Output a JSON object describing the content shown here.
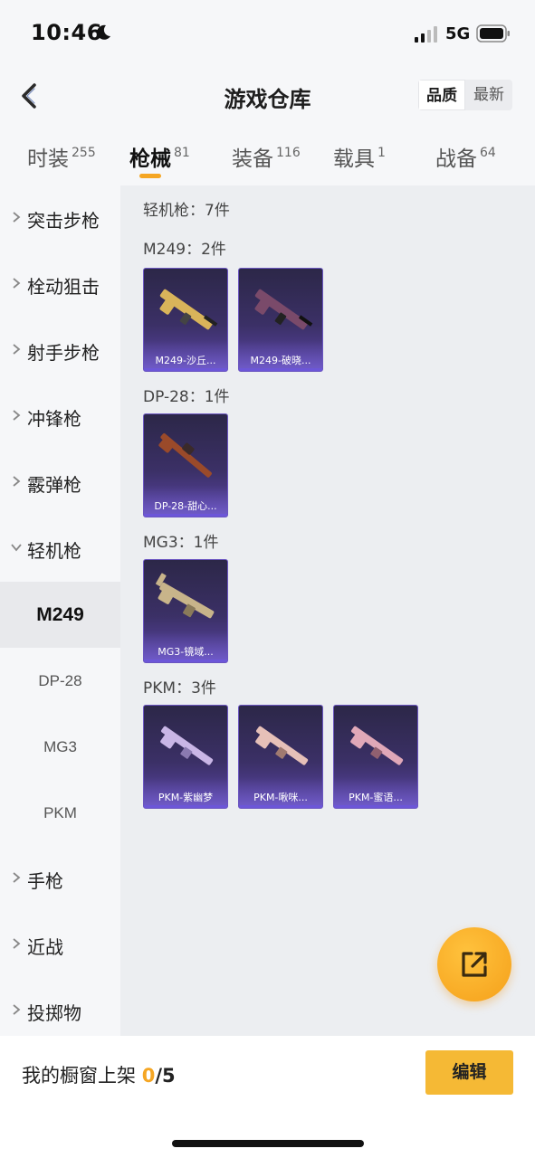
{
  "status": {
    "time": "10:46",
    "network": "5G"
  },
  "header": {
    "title": "游戏仓库",
    "sort_options": [
      "品质",
      "最新"
    ],
    "active_sort": "品质"
  },
  "tabs": [
    {
      "label": "时装",
      "count": "255"
    },
    {
      "label": "枪械",
      "count": "81"
    },
    {
      "label": "装备",
      "count": "116"
    },
    {
      "label": "载具",
      "count": "1"
    },
    {
      "label": "战备",
      "count": "64"
    }
  ],
  "active_tab": "枪械",
  "sidebar": {
    "categories": [
      "突击步枪",
      "栓动狙击",
      "射手步枪",
      "冲锋枪",
      "霰弹枪",
      "轻机枪"
    ],
    "subitems": [
      "M249",
      "DP-28",
      "MG3",
      "PKM"
    ],
    "more_categories": [
      "手枪",
      "近战",
      "投掷物"
    ],
    "active_subitem": "M249"
  },
  "content": {
    "summary": "轻机枪：7件",
    "groups": [
      {
        "label": "M249：2件",
        "items": [
          {
            "name": "M249-沙丘...",
            "color": "#d9b45a"
          },
          {
            "name": "M249-破晓...",
            "color": "#7a4a6a"
          }
        ]
      },
      {
        "label": "DP-28：1件",
        "items": [
          {
            "name": "DP-28-甜心...",
            "color": "#9a4a2a"
          }
        ]
      },
      {
        "label": "MG3：1件",
        "items": [
          {
            "name": "MG3-镜域...",
            "color": "#c8b48a"
          }
        ]
      },
      {
        "label": "PKM：3件",
        "items": [
          {
            "name": "PKM-紫幽梦",
            "color": "#c9b6e6"
          },
          {
            "name": "PKM-啾咪...",
            "color": "#e6c0b8"
          },
          {
            "name": "PKM-蜜语...",
            "color": "#e0a8b8"
          }
        ]
      }
    ]
  },
  "bottom": {
    "showcase_label": "我的橱窗上架",
    "showcase_count": "0",
    "showcase_total": "/5",
    "edit_label": "编辑"
  },
  "colors": {
    "accent": "#f5a623",
    "card_purple": "#3b3066"
  }
}
